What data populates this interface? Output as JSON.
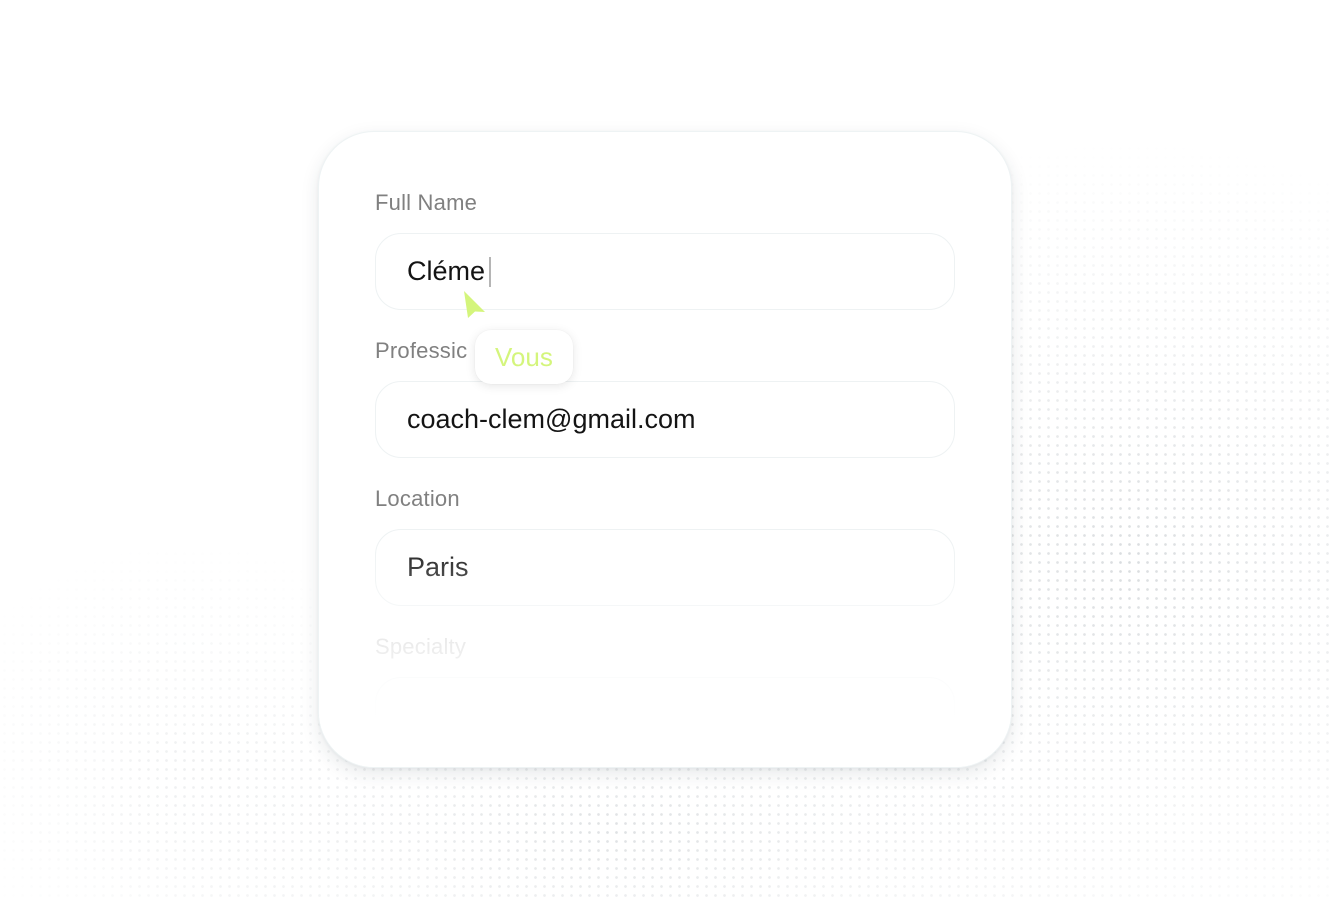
{
  "form": {
    "full_name": {
      "label": "Full Name",
      "value": "Cléme"
    },
    "profession": {
      "label": "Professic",
      "value": "coach-clem@gmail.com"
    },
    "location": {
      "label": "Location",
      "value": "Paris"
    },
    "specialty": {
      "label": "Specialty",
      "value": ""
    }
  },
  "collaborator_cursor": {
    "label": "Vous",
    "color": "#d4f57c"
  },
  "icons": {
    "cursor": "cursor-arrow-icon"
  }
}
